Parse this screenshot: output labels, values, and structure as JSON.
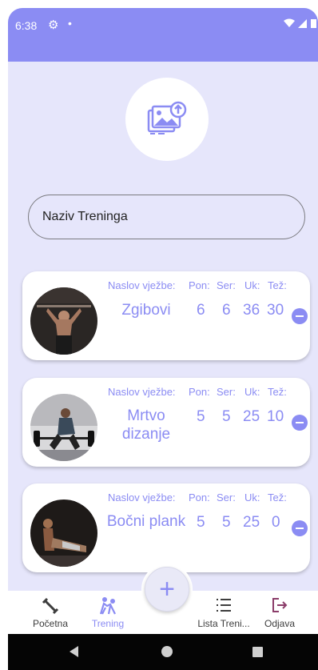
{
  "status_bar": {
    "time": "6:38",
    "icons": [
      "gear-icon",
      "dot-icon",
      "wifi-icon",
      "signal-icon",
      "battery-icon"
    ]
  },
  "image_picker": {
    "icon": "image-upload-icon"
  },
  "training_name": {
    "placeholder": "Naziv Treninga",
    "value": ""
  },
  "headers": {
    "exercise": "Naslov vježbe:",
    "reps": "Pon:",
    "sets": "Ser:",
    "total": "Uk:",
    "weight": "Tež:"
  },
  "exercises": [
    {
      "title": "Zgibovi",
      "reps": "6",
      "sets": "6",
      "total": "36",
      "weight": "30"
    },
    {
      "title": "Mrtvo dizanje",
      "reps": "5",
      "sets": "5",
      "total": "25",
      "weight": "10"
    },
    {
      "title": "Bočni plank",
      "reps": "5",
      "sets": "5",
      "total": "25",
      "weight": "0"
    }
  ],
  "fab": {
    "label": "+"
  },
  "bottom_nav": [
    {
      "label": "Početna",
      "icon": "dumbbell-icon"
    },
    {
      "label": "Trening",
      "icon": "workout-icon",
      "active": true
    },
    {
      "label": "Lista Treni...",
      "icon": "list-icon"
    },
    {
      "label": "Odjava",
      "icon": "logout-icon"
    }
  ],
  "colors": {
    "accent": "#8b8cf3",
    "background": "#e6e6fb",
    "card": "#ffffff"
  }
}
